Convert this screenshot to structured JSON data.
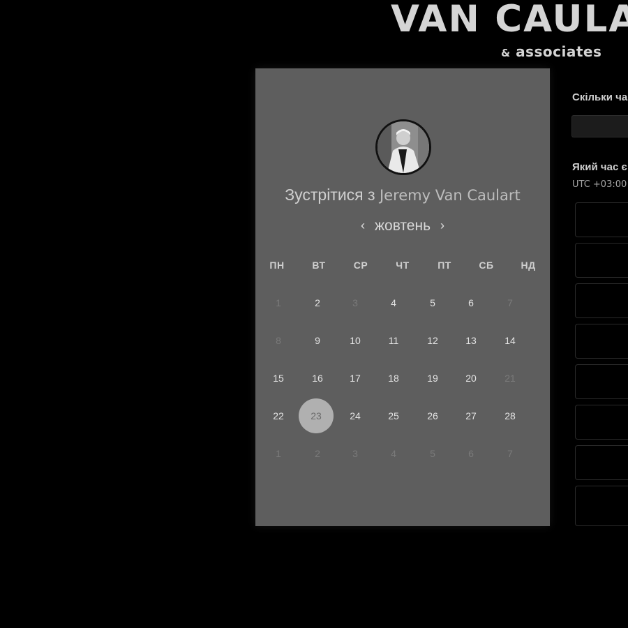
{
  "brand": {
    "name": "VAN CAULA",
    "amp": "&",
    "sub": "associates"
  },
  "meeting": {
    "prefix": "Зустрітися з",
    "host": "Jeremy Van Caulart"
  },
  "calendar": {
    "month": "жовтень",
    "prev_arrow": "‹",
    "next_arrow": "›",
    "weekdays": [
      "ПН",
      "ВТ",
      "СР",
      "ЧТ",
      "ПТ",
      "СБ",
      "НД"
    ],
    "weeks": [
      [
        "1",
        "2",
        "3",
        "4",
        "5",
        "6",
        "7"
      ],
      [
        "8",
        "9",
        "10",
        "11",
        "12",
        "13",
        "14"
      ],
      [
        "15",
        "16",
        "17",
        "18",
        "19",
        "20",
        "21"
      ],
      [
        "22",
        "23",
        "24",
        "25",
        "26",
        "27",
        "28"
      ],
      [
        "1",
        "2",
        "3",
        "4",
        "5",
        "6",
        "7"
      ]
    ],
    "selected_day": "23"
  },
  "form": {
    "duration_label": "Скільки ча",
    "time_label": "Який час є",
    "timezone": "UTC +03:00"
  },
  "colors": {
    "panel": "#5e5e5e",
    "selected": "#b0b0b0"
  }
}
